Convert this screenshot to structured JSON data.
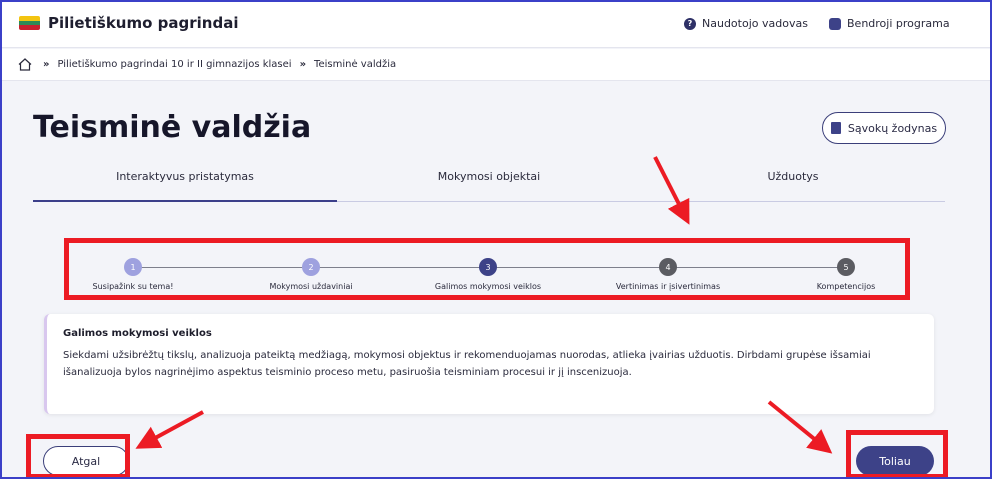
{
  "header": {
    "brand": "Pilietiškumo pagrindai",
    "flag_colors": [
      "#f3c410",
      "#2e8b57",
      "#c8202f"
    ],
    "links": [
      {
        "label": "Naudotojo vadovas",
        "icon": "question-circle-icon",
        "color": "#2e3066"
      },
      {
        "label": "Bendroji programa",
        "icon": "book-icon",
        "color": "#3d4288"
      }
    ]
  },
  "breadcrumb": {
    "home_icon": "home-icon",
    "separator": "»",
    "items": [
      "Pilietiškumo pagrindai 10 ir II gimnazijos klasei",
      "Teisminė valdžia"
    ]
  },
  "page": {
    "title": "Teisminė valdžia",
    "glossary_button": "Sąvokų žodynas"
  },
  "tabs": [
    {
      "label": "Interaktyvus pristatymas",
      "active": true
    },
    {
      "label": "Mokymosi objektai",
      "active": false
    },
    {
      "label": "Užduotys",
      "active": false
    }
  ],
  "stepper": {
    "steps": [
      {
        "number": "1",
        "label": "Susipažink su tema!",
        "color": "#9ea1df"
      },
      {
        "number": "2",
        "label": "Mokymosi uždaviniai",
        "color": "#9ea1df"
      },
      {
        "number": "3",
        "label": "Galimos mokymosi veiklos",
        "color": "#3d4288"
      },
      {
        "number": "4",
        "label": "Vertinimas ir įsivertinimas",
        "color": "#5b5c62"
      },
      {
        "number": "5",
        "label": "Kompetencijos",
        "color": "#5b5c62"
      }
    ]
  },
  "card": {
    "title": "Galimos mokymosi veiklos",
    "text": "Siekdami užsibrėžtų tikslų, analizuoja pateiktą medžiagą, mokymosi objektus ir rekomenduojamas nuorodas, atlieka įvairias užduotis. Dirbdami grupėse išsamiai išanalizuoja bylos nagrinėjimo aspektus teisminio proceso metu, pasiruošia teisminiam procesui ir jį inscenizuoja."
  },
  "nav": {
    "back": "Atgal",
    "next": "Toliau"
  },
  "colors": {
    "accent": "#3d4288",
    "annotation_red": "#ec1b24"
  }
}
